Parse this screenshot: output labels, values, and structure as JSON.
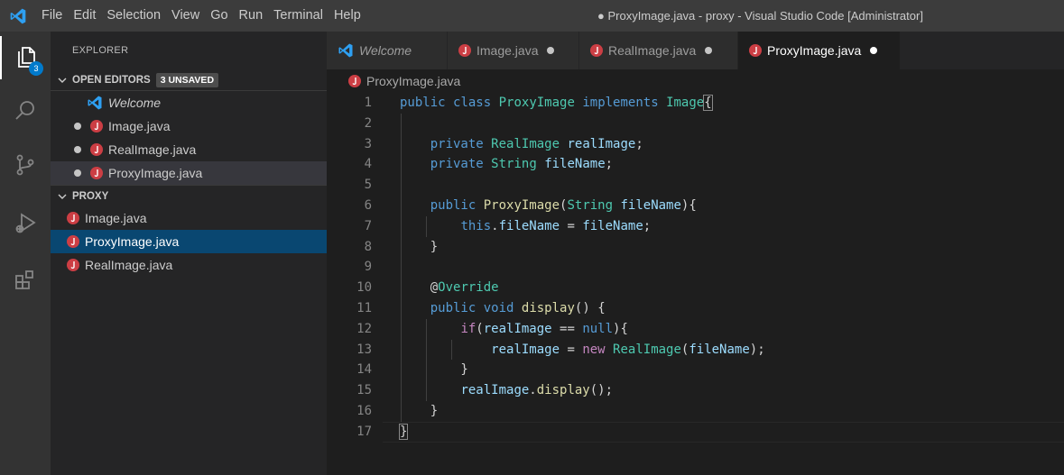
{
  "titlebar": {
    "menu": [
      "File",
      "Edit",
      "Selection",
      "View",
      "Go",
      "Run",
      "Terminal",
      "Help"
    ],
    "window_title": "● ProxyImage.java - proxy - Visual Studio Code [Administrator]"
  },
  "activitybar": {
    "explorer_badge": "3"
  },
  "sidebar": {
    "title": "EXPLORER",
    "open_editors": {
      "label": "OPEN EDITORS",
      "badge": "3 UNSAVED",
      "items": [
        "Welcome",
        "Image.java",
        "RealImage.java",
        "ProxyImage.java"
      ]
    },
    "project": {
      "label": "PROXY",
      "items": [
        "Image.java",
        "ProxyImage.java",
        "RealImage.java"
      ]
    }
  },
  "tabs": [
    "Welcome",
    "Image.java",
    "RealImage.java",
    "ProxyImage.java"
  ],
  "breadcrumb": "ProxyImage.java",
  "editor": {
    "line_numbers": [
      "1",
      "2",
      "3",
      "4",
      "5",
      "6",
      "7",
      "8",
      "9",
      "10",
      "11",
      "12",
      "13",
      "14",
      "15",
      "16",
      "17"
    ]
  },
  "colors": {
    "accent": "#007acc",
    "java_icon": "#cc3e44",
    "selection": "#094771"
  }
}
